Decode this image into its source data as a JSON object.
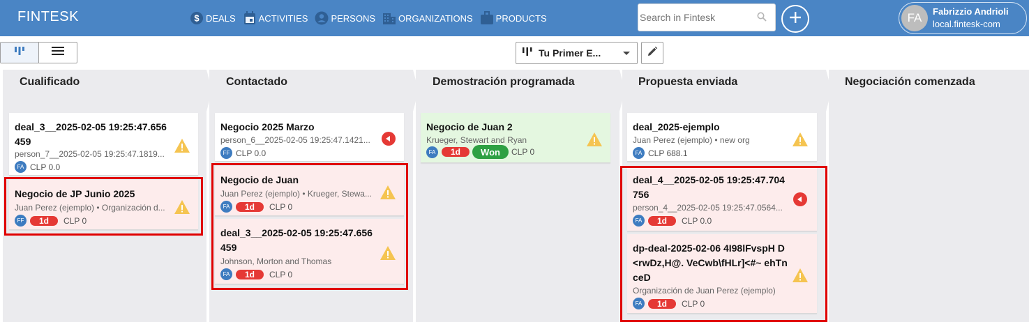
{
  "app": {
    "brand": "FINTESK"
  },
  "nav": [
    {
      "label": "DEALS",
      "icon": "dollar-icon"
    },
    {
      "label": "ACTIVITIES",
      "icon": "calendar-icon"
    },
    {
      "label": "PERSONS",
      "icon": "person-icon"
    },
    {
      "label": "ORGANIZATIONS",
      "icon": "building-icon"
    },
    {
      "label": "PRODUCTS",
      "icon": "briefcase-icon"
    }
  ],
  "search": {
    "placeholder": "Search in Fintesk"
  },
  "user": {
    "initials": "FA",
    "name": "Fabrizzio Andrioli",
    "org": "local.fintesk-com"
  },
  "toolbar": {
    "pipeline": "Tu Primer E..."
  },
  "colors": {
    "nav_bg": "#4a85c5",
    "stage_bg": "#ebebee",
    "badge_red": "#e53935",
    "won_green": "#2ea043",
    "highlight": "#e00000",
    "warning": "#f5c451"
  },
  "stages": [
    {
      "title": "Cualificado",
      "deals": [
        {
          "title": "deal_3__2025-02-05 19:25:47.656 459",
          "subtitle": "person_7__2025-02-05 19:25:47.1819...",
          "owner": "FA",
          "value": "CLP 0.0",
          "status": "warning"
        },
        {
          "title": "Negocio de JP Junio 2025",
          "subtitle": "Juan Perez (ejemplo) • Organización d...",
          "owner": "FF",
          "badge": "1d",
          "value": "CLP 0",
          "status": "warning"
        }
      ]
    },
    {
      "title": "Contactado",
      "deals": [
        {
          "title": "Negocio 2025 Marzo",
          "subtitle": "person_6__2025-02-05 19:25:47.1421...",
          "owner": "FF",
          "value": "CLP 0.0",
          "status": "overdue"
        },
        {
          "title": "Negocio de Juan",
          "subtitle": "Juan Perez (ejemplo) • Krueger, Stewa...",
          "owner": "FA",
          "badge": "1d",
          "value": "CLP 0",
          "status": "warning"
        },
        {
          "title": "deal_3__2025-02-05 19:25:47.656 459",
          "subtitle": "Johnson, Morton and Thomas",
          "owner": "FA",
          "badge": "1d",
          "value": "CLP 0",
          "status": "warning"
        }
      ]
    },
    {
      "title": "Demostración programada",
      "deals": [
        {
          "title": "Negocio de Juan 2",
          "subtitle": "Krueger, Stewart and Ryan",
          "owner": "FA",
          "badge": "1d",
          "won": "Won",
          "value": "CLP 0",
          "status": "warning"
        }
      ]
    },
    {
      "title": "Propuesta enviada",
      "deals": [
        {
          "title": "deal_2025-ejemplo",
          "subtitle": "Juan Perez (ejemplo) • new org",
          "owner": "FA",
          "value": "CLP 688.1",
          "status": "warning"
        },
        {
          "title": "deal_4__2025-02-05 19:25:47.704 756",
          "subtitle": "person_4__2025-02-05 19:25:47.0564...",
          "owner": "FA",
          "badge": "1d",
          "value": "CLP 0.0",
          "status": "overdue"
        },
        {
          "title": "dp-deal-2025-02-06 4I98lFvspH D <rwDz,H@. VeCwb\\fHLr]<#~ ehTn ceD",
          "subtitle": "Organización de Juan Perez (ejemplo)",
          "owner": "FA",
          "badge": "1d",
          "value": "CLP 0",
          "status": "warning"
        }
      ]
    },
    {
      "title": "Negociación comenzada",
      "deals": []
    }
  ]
}
